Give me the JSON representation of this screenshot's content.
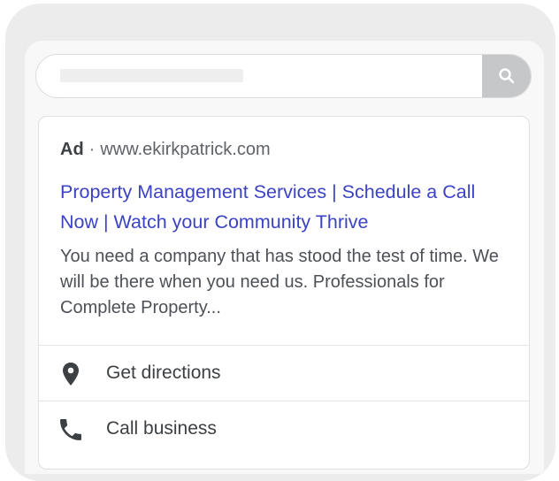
{
  "search": {
    "button_icon": "search-icon"
  },
  "ad": {
    "badge": "Ad",
    "separator": "·",
    "display_url": "www.ekirkpatrick.com",
    "title": "Property Management Services | Schedule a Call Now | Watch your Community Thrive",
    "description": "You need a company that has stood the test of time. We will be there when you need us. Professionals for Complete Property..."
  },
  "actions": [
    {
      "icon": "location-pin-icon",
      "label": "Get directions"
    },
    {
      "icon": "phone-icon",
      "label": "Call business"
    }
  ],
  "colors": {
    "title_link": "#3b43c4",
    "frame": "#ececed",
    "search_button": "#c6c7c9"
  }
}
